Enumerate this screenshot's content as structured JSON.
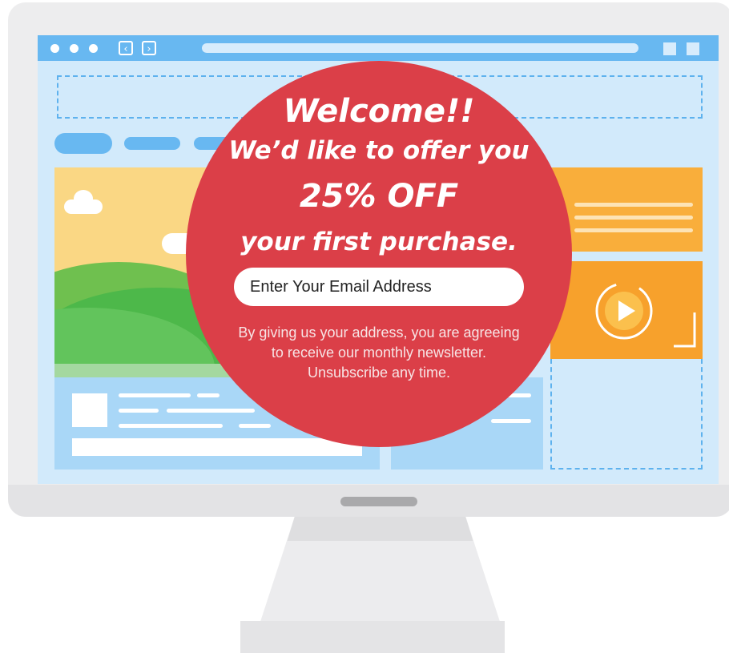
{
  "popup": {
    "headline": "Welcome!!",
    "subhead": "We’d like to offer you",
    "offer": "25% OFF",
    "offer_detail": "your first purchase.",
    "email_placeholder": "Enter Your Email Address",
    "disclaimer": "By giving us your address, you are agreeing to receive our monthly newsletter. Unsubscribe any time."
  },
  "browser": {
    "back_glyph": "‹",
    "forward_glyph": "›"
  },
  "colors": {
    "popup_bg": "#db3f48",
    "titlebar": "#68b8f1",
    "screen_bg": "#d2eafb",
    "accent_orange": "#f9ae3b"
  },
  "icons": [
    "window-dot",
    "back-arrow-icon",
    "forward-arrow-icon",
    "play-icon",
    "cloud-icon"
  ]
}
